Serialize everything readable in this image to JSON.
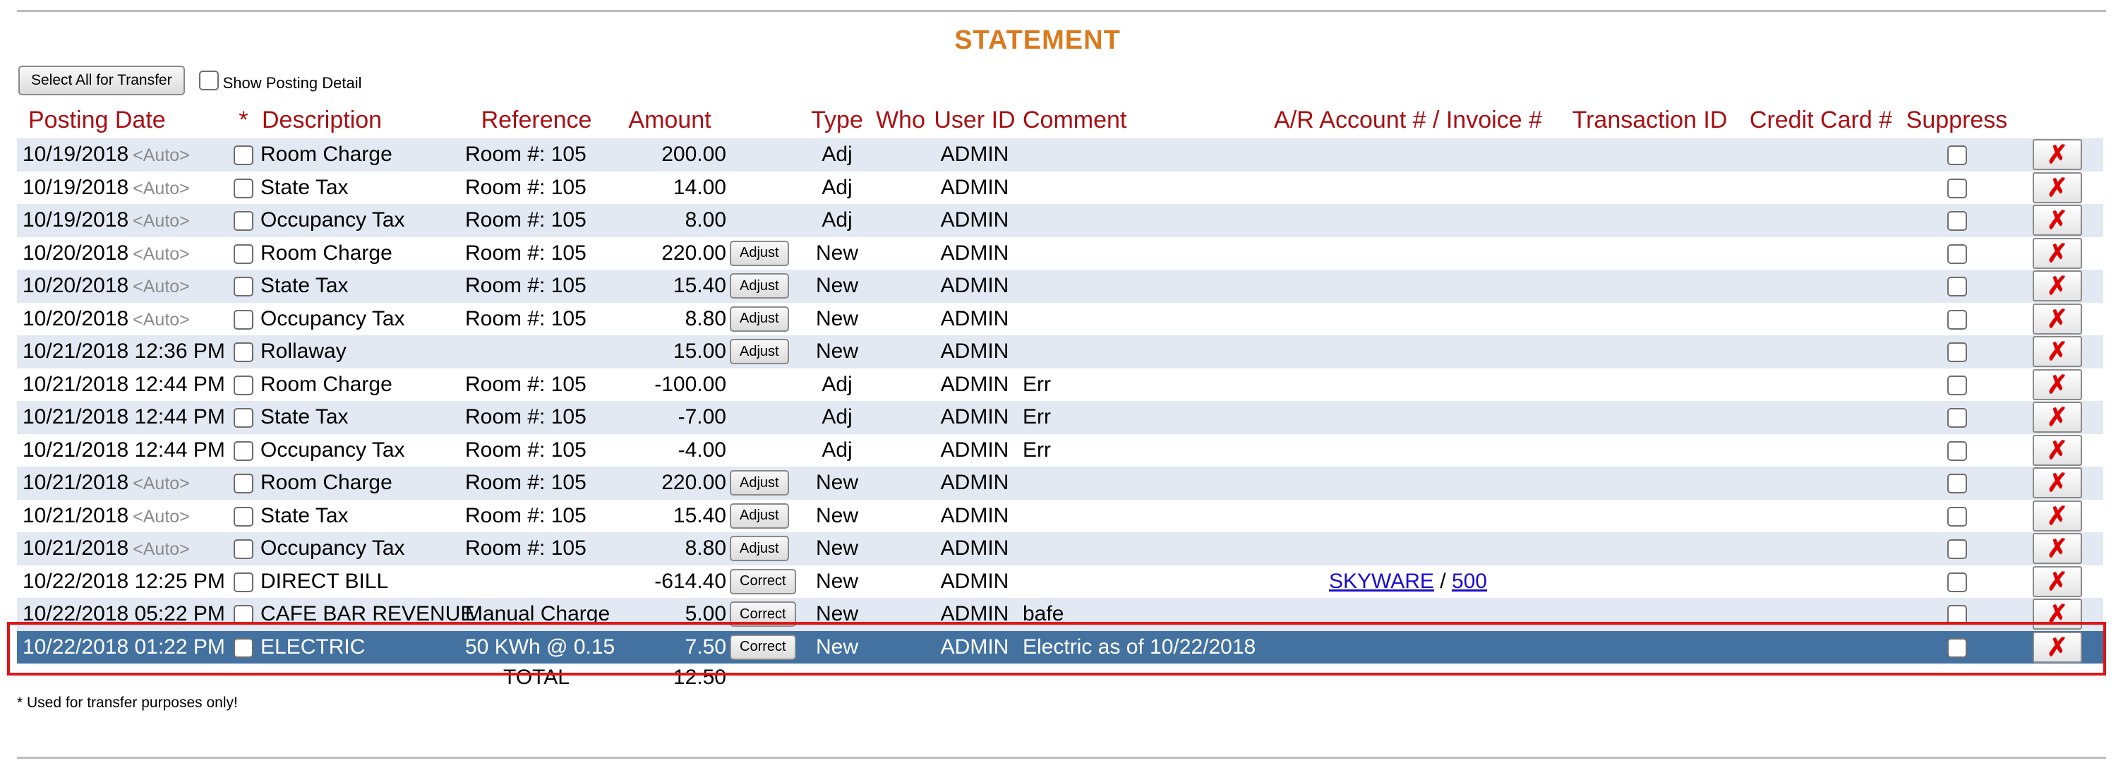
{
  "title": "STATEMENT",
  "controls": {
    "select_all_label": "Select All for Transfer",
    "show_posting_detail_label": "Show Posting Detail"
  },
  "columns": [
    "Posting Date",
    "*",
    "Description",
    "Reference",
    "Amount",
    "",
    "Type",
    "Who",
    "User ID",
    "Comment",
    "A/R Account # / Invoice #",
    "Transaction ID",
    "Credit Card #",
    "Suppress",
    ""
  ],
  "rows": [
    {
      "date": "10/19/2018",
      "auto": "<Auto>",
      "description": "Room Charge",
      "reference": "Room #: 105",
      "amount": "200.00",
      "action": "",
      "type": "Adj",
      "who": "",
      "user_id": "ADMIN",
      "comment": "",
      "ar_account": "",
      "ar_sep": "",
      "invoice": ""
    },
    {
      "date": "10/19/2018",
      "auto": "<Auto>",
      "description": "State Tax",
      "reference": "Room #: 105",
      "amount": "14.00",
      "action": "",
      "type": "Adj",
      "who": "",
      "user_id": "ADMIN",
      "comment": "",
      "ar_account": "",
      "ar_sep": "",
      "invoice": ""
    },
    {
      "date": "10/19/2018",
      "auto": "<Auto>",
      "description": "Occupancy Tax",
      "reference": "Room #: 105",
      "amount": "8.00",
      "action": "",
      "type": "Adj",
      "who": "",
      "user_id": "ADMIN",
      "comment": "",
      "ar_account": "",
      "ar_sep": "",
      "invoice": ""
    },
    {
      "date": "10/20/2018",
      "auto": "<Auto>",
      "description": "Room Charge",
      "reference": "Room #: 105",
      "amount": "220.00",
      "action": "Adjust",
      "type": "New",
      "who": "",
      "user_id": "ADMIN",
      "comment": "",
      "ar_account": "",
      "ar_sep": "",
      "invoice": ""
    },
    {
      "date": "10/20/2018",
      "auto": "<Auto>",
      "description": "State Tax",
      "reference": "Room #: 105",
      "amount": "15.40",
      "action": "Adjust",
      "type": "New",
      "who": "",
      "user_id": "ADMIN",
      "comment": "",
      "ar_account": "",
      "ar_sep": "",
      "invoice": ""
    },
    {
      "date": "10/20/2018",
      "auto": "<Auto>",
      "description": "Occupancy Tax",
      "reference": "Room #: 105",
      "amount": "8.80",
      "action": "Adjust",
      "type": "New",
      "who": "",
      "user_id": "ADMIN",
      "comment": "",
      "ar_account": "",
      "ar_sep": "",
      "invoice": ""
    },
    {
      "date": "10/21/2018 12:36 PM",
      "auto": "",
      "description": "Rollaway",
      "reference": "",
      "amount": "15.00",
      "action": "Adjust",
      "type": "New",
      "who": "",
      "user_id": "ADMIN",
      "comment": "",
      "ar_account": "",
      "ar_sep": "",
      "invoice": ""
    },
    {
      "date": "10/21/2018 12:44 PM",
      "auto": "",
      "description": "Room Charge",
      "reference": "Room #: 105",
      "amount": "-100.00",
      "action": "",
      "type": "Adj",
      "who": "",
      "user_id": "ADMIN",
      "comment": "Err",
      "ar_account": "",
      "ar_sep": "",
      "invoice": ""
    },
    {
      "date": "10/21/2018 12:44 PM",
      "auto": "",
      "description": "State Tax",
      "reference": "Room #: 105",
      "amount": "-7.00",
      "action": "",
      "type": "Adj",
      "who": "",
      "user_id": "ADMIN",
      "comment": "Err",
      "ar_account": "",
      "ar_sep": "",
      "invoice": ""
    },
    {
      "date": "10/21/2018 12:44 PM",
      "auto": "",
      "description": "Occupancy Tax",
      "reference": "Room #: 105",
      "amount": "-4.00",
      "action": "",
      "type": "Adj",
      "who": "",
      "user_id": "ADMIN",
      "comment": "Err",
      "ar_account": "",
      "ar_sep": "",
      "invoice": ""
    },
    {
      "date": "10/21/2018",
      "auto": "<Auto>",
      "description": "Room Charge",
      "reference": "Room #: 105",
      "amount": "220.00",
      "action": "Adjust",
      "type": "New",
      "who": "",
      "user_id": "ADMIN",
      "comment": "",
      "ar_account": "",
      "ar_sep": "",
      "invoice": ""
    },
    {
      "date": "10/21/2018",
      "auto": "<Auto>",
      "description": "State Tax",
      "reference": "Room #: 105",
      "amount": "15.40",
      "action": "Adjust",
      "type": "New",
      "who": "",
      "user_id": "ADMIN",
      "comment": "",
      "ar_account": "",
      "ar_sep": "",
      "invoice": ""
    },
    {
      "date": "10/21/2018",
      "auto": "<Auto>",
      "description": "Occupancy Tax",
      "reference": "Room #: 105",
      "amount": "8.80",
      "action": "Adjust",
      "type": "New",
      "who": "",
      "user_id": "ADMIN",
      "comment": "",
      "ar_account": "",
      "ar_sep": "",
      "invoice": ""
    },
    {
      "date": "10/22/2018 12:25 PM",
      "auto": "",
      "description": "DIRECT BILL",
      "reference": "",
      "amount": "-614.40",
      "action": "Correct",
      "type": "New",
      "who": "",
      "user_id": "ADMIN",
      "comment": "",
      "ar_account": "SKYWARE",
      "ar_sep": " / ",
      "invoice": "500"
    },
    {
      "date": "10/22/2018 05:22 PM",
      "auto": "",
      "description": "CAFE BAR REVENUE",
      "reference": "Manual Charge",
      "amount": "5.00",
      "action": "Correct",
      "type": "New",
      "who": "",
      "user_id": "ADMIN",
      "comment": "bafe",
      "ar_account": "",
      "ar_sep": "",
      "invoice": ""
    },
    {
      "date": "10/22/2018 01:22 PM",
      "auto": "",
      "description": "ELECTRIC",
      "reference": "50 KWh @ 0.15",
      "amount": "7.50",
      "action": "Correct",
      "type": "New",
      "who": "",
      "user_id": "ADMIN",
      "comment": "Electric as of 10/22/2018",
      "ar_account": "",
      "ar_sep": "",
      "invoice": "",
      "selected": true
    }
  ],
  "total": {
    "label": "TOTAL",
    "amount": "12.50"
  },
  "footnote": "* Used for transfer purposes only!",
  "icons": {
    "delete": "red-x-icon"
  },
  "colors": {
    "title": "#d97a1e",
    "header": "#a80f14",
    "row_alt": "#e3e9f2",
    "selected_row": "#4472a0",
    "highlight": "#e01616",
    "link": "#1a0dcc"
  }
}
